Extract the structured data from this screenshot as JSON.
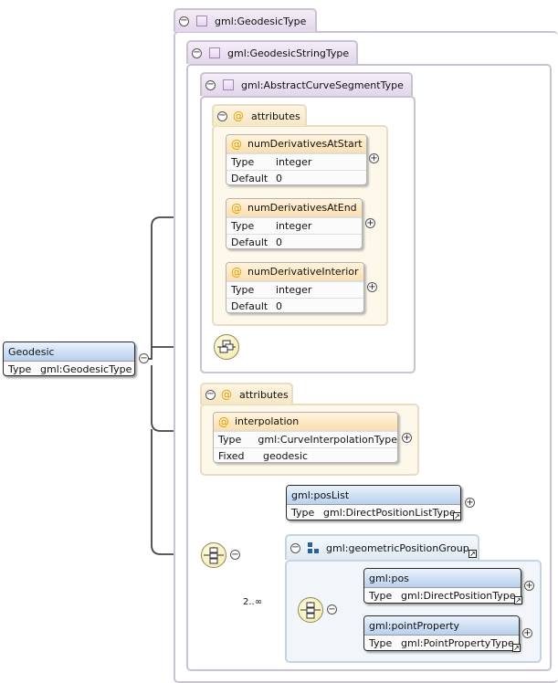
{
  "types": {
    "geodesic_type": "gml:GeodesicType",
    "geodesic_string_type": "gml:GeodesicStringType",
    "abstract_curve_segment_type": "gml:AbstractCurveSegmentType"
  },
  "labels": {
    "attributes": "attributes",
    "type": "Type",
    "default": "Default",
    "fixed": "Fixed"
  },
  "attributes_inner": [
    {
      "name": "numDerivativesAtStart",
      "type": "integer",
      "default": "0"
    },
    {
      "name": "numDerivativesAtEnd",
      "type": "integer",
      "default": "0"
    },
    {
      "name": "numDerivativeInterior",
      "type": "integer",
      "default": "0"
    }
  ],
  "interpolation": {
    "name": "interpolation",
    "type": "gml:CurveInterpolationType",
    "fixed": "geodesic"
  },
  "root": {
    "name": "Geodesic",
    "type": "gml:GeodesicType"
  },
  "pos_list": {
    "name": "gml:posList",
    "type": "gml:DirectPositionListType"
  },
  "group": {
    "name": "gml:geometricPositionGroup"
  },
  "pos": {
    "name": "gml:pos",
    "type": "gml:DirectPositionType"
  },
  "point_property": {
    "name": "gml:pointProperty",
    "type": "gml:PointPropertyType"
  },
  "cardinality": "2..∞",
  "icons": {
    "collapse": "minus-circle-icon",
    "expand": "plus-circle-icon",
    "link": "link-arrow-icon",
    "sequence": "sequence-icon",
    "choice": "choice-icon"
  }
}
